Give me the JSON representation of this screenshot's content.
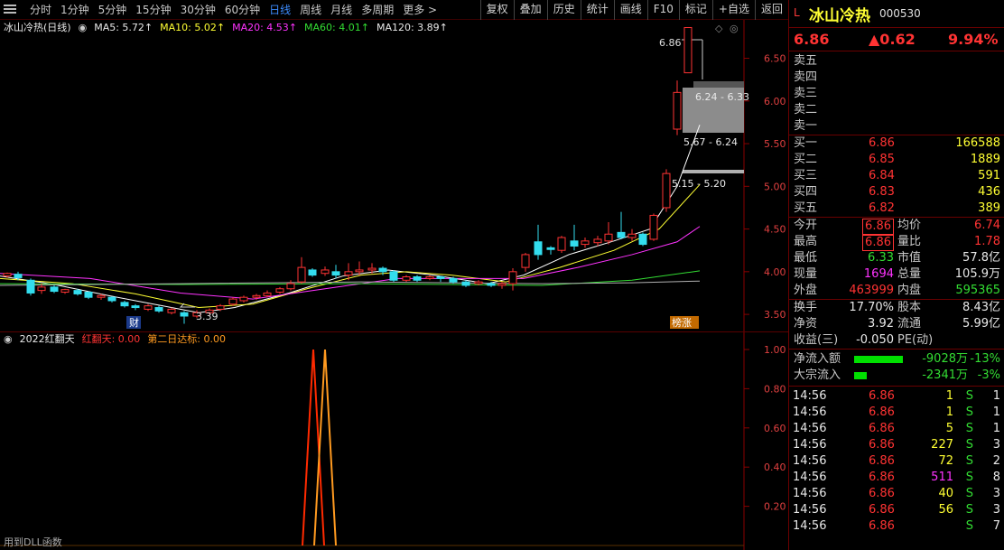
{
  "toolbar": {
    "periods": [
      "分时",
      "1分钟",
      "5分钟",
      "15分钟",
      "30分钟",
      "60分钟",
      "日线",
      "周线",
      "月线",
      "多周期",
      "更多 >"
    ],
    "active_period": "日线",
    "tools": [
      "复权",
      "叠加",
      "历史",
      "统计",
      "画线",
      "F10",
      "标记",
      "+自选",
      "返回"
    ]
  },
  "main_chart": {
    "legend": {
      "title": "冰山冷热(日线)",
      "ma5": "MA5: 5.72↑",
      "ma10": "MA10: 5.02↑",
      "ma20": "MA20: 4.53↑",
      "ma60": "MA60: 4.01↑",
      "ma120": "MA120: 3.89↑"
    },
    "y_ticks": [
      "6.50",
      "6.00",
      "5.50",
      "5.00",
      "4.50",
      "4.00",
      "3.50"
    ],
    "annotations": {
      "high": "6.86",
      "low": "3.39",
      "gap1": "6.24 - 6.33",
      "gap2": "5.67 - 6.24",
      "gap3": "5.15 - 5.20",
      "tag_cai": "财",
      "tag_bang": "榜涨"
    }
  },
  "indicator": {
    "legend": {
      "name": "2022红翻天",
      "series1": "红翻天: 0.00",
      "series2": "第二日达标: 0.00"
    },
    "y_ticks": [
      "1.00",
      "0.80",
      "0.60",
      "0.40",
      "0.20"
    ],
    "footer": "用到DLL函数"
  },
  "chart_data": {
    "type": "candlestick",
    "ylim": [
      3.3,
      6.95
    ],
    "ma_values": {
      "MA5": 5.72,
      "MA10": 5.02,
      "MA20": 4.53,
      "MA60": 4.01,
      "MA120": 3.89
    },
    "high": 6.86,
    "low": 3.39
  },
  "quote": {
    "market": "L",
    "name": "冰山冷热",
    "code": "000530",
    "price": "6.86",
    "change": "▲0.62",
    "pct": "9.94%",
    "sells": [
      "卖五",
      "卖四",
      "卖三",
      "卖二",
      "卖一"
    ],
    "buys": [
      {
        "label": "买一",
        "price": "6.86",
        "vol": "166588"
      },
      {
        "label": "买二",
        "price": "6.85",
        "vol": "1889"
      },
      {
        "label": "买三",
        "price": "6.84",
        "vol": "591"
      },
      {
        "label": "买四",
        "price": "6.83",
        "vol": "436"
      },
      {
        "label": "买五",
        "price": "6.82",
        "vol": "389"
      }
    ],
    "stats": [
      {
        "l1": "今开",
        "v1": "6.86",
        "l2": "均价",
        "v2": "6.74"
      },
      {
        "l1": "最高",
        "v1": "6.86",
        "l2": "量比",
        "v2": "1.78"
      },
      {
        "l1": "最低",
        "v1": "6.33",
        "l2": "市值",
        "v2": "57.8亿"
      },
      {
        "l1": "现量",
        "v1": "1694",
        "l2": "总量",
        "v2": "105.9万"
      },
      {
        "l1": "外盘",
        "v1": "463999",
        "l2": "内盘",
        "v2": "595365"
      }
    ],
    "fund": [
      {
        "l1": "换手",
        "v1": "17.70%",
        "l2": "股本",
        "v2": "8.43亿"
      },
      {
        "l1": "净资",
        "v1": "3.92",
        "l2": "流通",
        "v2": "5.99亿"
      },
      {
        "l1": "收益(三)",
        "v1": "-0.050",
        "l2": "PE(动)",
        "v2": ""
      }
    ],
    "flow": [
      {
        "label": "净流入额",
        "value": "-9028万",
        "pct": "-13%"
      },
      {
        "label": "大宗流入",
        "value": "-2341万",
        "pct": "-3%"
      }
    ],
    "ticks": [
      {
        "time": "14:56",
        "price": "6.86",
        "vol": "1",
        "side": "S",
        "n": "1"
      },
      {
        "time": "14:56",
        "price": "6.86",
        "vol": "1",
        "side": "S",
        "n": "1"
      },
      {
        "time": "14:56",
        "price": "6.86",
        "vol": "5",
        "side": "S",
        "n": "1"
      },
      {
        "time": "14:56",
        "price": "6.86",
        "vol": "227",
        "side": "S",
        "n": "3"
      },
      {
        "time": "14:56",
        "price": "6.86",
        "vol": "72",
        "side": "S",
        "n": "2"
      },
      {
        "time": "14:56",
        "price": "6.86",
        "vol": "511",
        "side": "S",
        "n": "8"
      },
      {
        "time": "14:56",
        "price": "6.86",
        "vol": "40",
        "side": "S",
        "n": "3"
      },
      {
        "time": "14:56",
        "price": "6.86",
        "vol": "56",
        "side": "S",
        "n": "3"
      },
      {
        "time": "14:56",
        "price": "6.86",
        "vol": "",
        "side": "S",
        "n": "7"
      }
    ]
  }
}
